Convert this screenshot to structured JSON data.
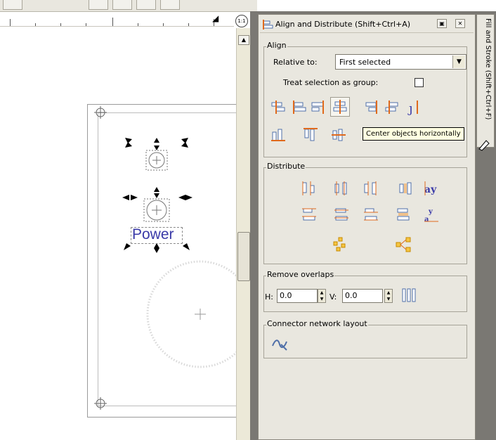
{
  "panel": {
    "title": "Align and Distribute (Shift+Ctrl+A)",
    "side_tab": "Fill and Stroke (Shift+Ctrl+F)"
  },
  "align": {
    "group_label": "Align",
    "relative_to_label": "Relative to:",
    "relative_to_value": "First selected",
    "treat_as_group_label": "Treat selection as group:",
    "treat_as_group_checked": false,
    "tooltip": "Center objects horizontally"
  },
  "distribute": {
    "group_label": "Distribute"
  },
  "remove_overlaps": {
    "group_label": "Remove overlaps",
    "h_label": "H:",
    "h_value": "0.0",
    "v_label": "V:",
    "v_value": "0.0"
  },
  "connector": {
    "group_label": "Connector network layout"
  },
  "canvas": {
    "selected_text": "Power",
    "text_color": "#3a3aa8"
  },
  "ruler": {
    "zoom_label": "1:1"
  },
  "colors": {
    "panel_bg": "#e9e7df",
    "icon_blue": "#4f6fa8",
    "icon_orange": "#e06a1c",
    "tooltip_bg": "#ffffe1"
  }
}
